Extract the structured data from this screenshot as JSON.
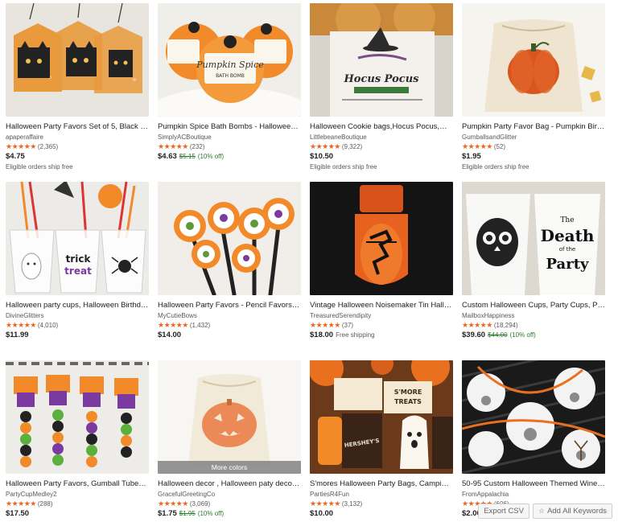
{
  "listings": [
    {
      "title": "Halloween Party Favors Set of 5, Black Cat ...",
      "shop": "apaperaffaire",
      "stars": "★★★★★",
      "count": "(2,365)",
      "price": "$4.75",
      "orig": "",
      "discount": "",
      "shipping_inline": "",
      "ship": "Eligible orders ship free",
      "more_colors": ""
    },
    {
      "title": "Pumpkin Spice Bath Bombs - Halloween Ba...",
      "shop": "SimplyACBoutique",
      "stars": "★★★★★",
      "count": "(232)",
      "price": "$4.63",
      "orig": "$5.15",
      "discount": "(10% off)",
      "shipping_inline": "",
      "ship": "",
      "more_colors": ""
    },
    {
      "title": "Halloween Cookie bags,Hocus Pocus,Witc...",
      "shop": "LittlebeaneBoutique",
      "stars": "★★★★★",
      "count": "(9,322)",
      "price": "$10.50",
      "orig": "",
      "discount": "",
      "shipping_inline": "",
      "ship": "Eligible orders ship free",
      "more_colors": ""
    },
    {
      "title": "Pumpkin Party Favor Bag - Pumpkin Birthda...",
      "shop": "GumballsandGlitter",
      "stars": "★★★★★",
      "count": "(52)",
      "price": "$1.95",
      "orig": "",
      "discount": "",
      "shipping_inline": "",
      "ship": "Eligible orders ship free",
      "more_colors": ""
    },
    {
      "title": "Halloween party cups, Halloween Birthday ...",
      "shop": "DivineGlitters",
      "stars": "★★★★★",
      "count": "(4,010)",
      "price": "$11.99",
      "orig": "",
      "discount": "",
      "shipping_inline": "",
      "ship": "",
      "more_colors": ""
    },
    {
      "title": "Halloween Party Favors - Pencil Favors - Tri...",
      "shop": "MyCutieBows",
      "stars": "★★★★★",
      "count": "(1,432)",
      "price": "$14.00",
      "orig": "",
      "discount": "",
      "shipping_inline": "",
      "ship": "",
      "more_colors": ""
    },
    {
      "title": "Vintage Halloween Noisemaker Tin Hallow...",
      "shop": "TreasuredSerendipity",
      "stars": "★★★★★",
      "count": "(37)",
      "price": "$18.00",
      "orig": "",
      "discount": "",
      "shipping_inline": "Free shipping",
      "ship": "",
      "more_colors": ""
    },
    {
      "title": "Custom Halloween Cups, Party Cups, Plasti...",
      "shop": "MailboxHappiness",
      "stars": "★★★★★",
      "count": "(18,294)",
      "price": "$39.60",
      "orig": "$44.00",
      "discount": "(10% off)",
      "shipping_inline": "",
      "ship": "",
      "more_colors": ""
    },
    {
      "title": "Halloween Party Favors, Gumball Tubes, G...",
      "shop": "PartyCupMedley2",
      "stars": "★★★★★",
      "count": "(288)",
      "price": "$17.50",
      "orig": "",
      "discount": "",
      "shipping_inline": "",
      "ship": "",
      "more_colors": ""
    },
    {
      "title": "Halloween decor , Halloween paty decor , ...",
      "shop": "GracefulGreetingCo",
      "stars": "★★★★★",
      "count": "(3,069)",
      "price": "$1.75",
      "orig": "$1.95",
      "discount": "(10% off)",
      "shipping_inline": "",
      "ship": "",
      "more_colors": "More colors"
    },
    {
      "title": "S'mores Halloween Party Bags, Camping H...",
      "shop": "PartiesR4Fun",
      "stars": "★★★★★",
      "count": "(3,132)",
      "price": "$10.00",
      "orig": "",
      "discount": "",
      "shipping_inline": "",
      "ship": "",
      "more_colors": ""
    },
    {
      "title": "50-95 Custom Halloween Themed Wine Ch...",
      "shop": "FromAppalachia",
      "stars": "★★★★★",
      "count": "(606)",
      "price": "$2.00",
      "orig": "",
      "discount": "",
      "shipping_inline": "",
      "ship": "",
      "more_colors": ""
    }
  ],
  "image_text": {
    "bath_bomb_1": "Pumpkin Spice",
    "bath_bomb_sub": "BATH BOMB",
    "hocus": "Hocus Pocus",
    "cups_trick": "trick",
    "cups_treat": "treat",
    "death_1": "The",
    "death_2": "Death",
    "death_3": "of the",
    "death_4": "Party",
    "smore_1": "S'MORE",
    "smore_2": "TREATS",
    "hershey": "HERSHEY'S"
  },
  "toolbar": {
    "export_label": "Export CSV",
    "keywords_label": "Add All Keywords",
    "star_icon": "☆"
  },
  "colors": {
    "accent_star": "#f1641e",
    "discount_green": "#2a7a2a"
  }
}
